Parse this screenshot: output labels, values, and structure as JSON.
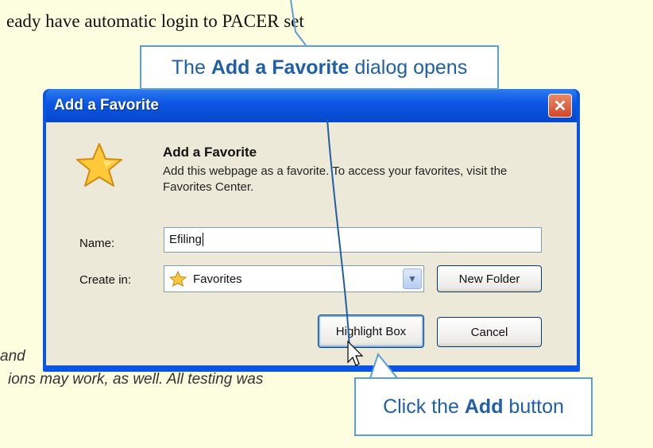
{
  "background": {
    "top_text": "eady have automatic login to PACER set",
    "left_text_1": "and",
    "left_text_2": "ions may work, as well. All testing was"
  },
  "callouts": {
    "top": {
      "prefix": "The ",
      "bold": "Add a Favorite",
      "suffix": " dialog opens"
    },
    "bottom": {
      "prefix": "Click the ",
      "bold": "Add",
      "suffix": " button"
    }
  },
  "dialog": {
    "title": "Add a Favorite",
    "close_glyph": "✕",
    "heading": "Add a Favorite",
    "description": "Add this webpage as a favorite. To access your favorites, visit the Favorites Center.",
    "name_label": "Name:",
    "name_value": "Efiling",
    "create_in_label": "Create in:",
    "create_in_value": "Favorites",
    "dropdown_glyph": "▼",
    "new_folder_label": "New Folder",
    "add_label": "Highlight Box",
    "cancel_label": "Cancel"
  },
  "icons": {
    "dialog_icon": "star-icon",
    "folder_icon": "favorites-star-icon",
    "pointer": "mouse-cursor-icon"
  },
  "colors": {
    "background": "#fdfde0",
    "callout_text": "#1f5fa8",
    "callout_border": "#5a9fd6",
    "titlebar": "#0a55e3",
    "dialog_body": "#ece9d8"
  }
}
